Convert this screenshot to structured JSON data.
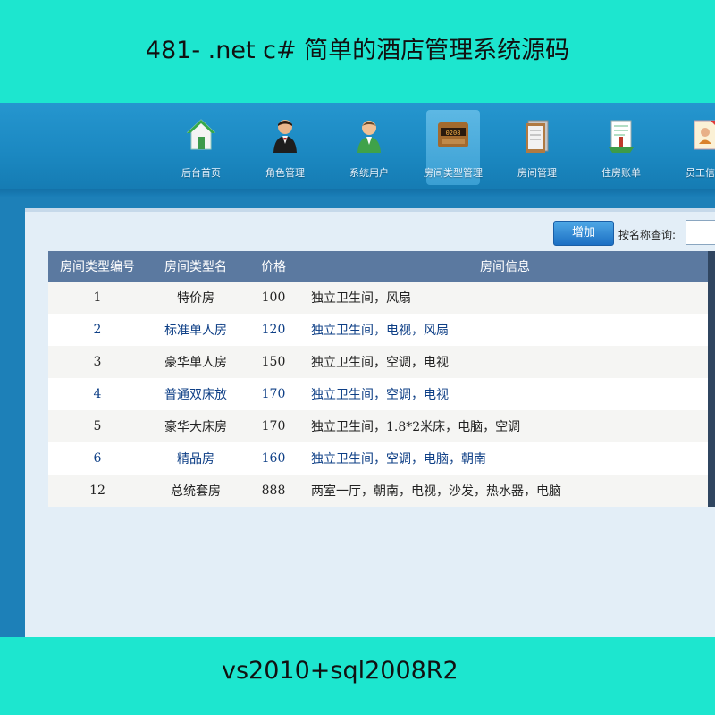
{
  "banner": {
    "title": "481- .net c# 简单的酒店管理系统源码",
    "footer": "vs2010+sql2008R2"
  },
  "nav": [
    {
      "label": "后台首页",
      "icon": "home-icon"
    },
    {
      "label": "角色管理",
      "icon": "waiter-icon"
    },
    {
      "label": "系统用户",
      "icon": "user-icon"
    },
    {
      "label": "房间类型管理",
      "icon": "room-type-icon",
      "active": true
    },
    {
      "label": "房间管理",
      "icon": "clipboard-icon"
    },
    {
      "label": "住房账单",
      "icon": "bill-icon"
    },
    {
      "label": "员工信息",
      "icon": "employee-icon"
    }
  ],
  "toolbar": {
    "add_label": "增加",
    "search_label": "按名称查询:",
    "search_value": ""
  },
  "table": {
    "headers": [
      "房间类型编号",
      "房间类型名",
      "价格",
      "房间信息"
    ],
    "rows": [
      {
        "id": "1",
        "name": "特价房",
        "price": "100",
        "info": "独立卫生间，风扇"
      },
      {
        "id": "2",
        "name": "标准单人房",
        "price": "120",
        "info": "独立卫生间，电视，风扇"
      },
      {
        "id": "3",
        "name": "豪华单人房",
        "price": "150",
        "info": "独立卫生间，空调，电视"
      },
      {
        "id": "4",
        "name": "普通双床放",
        "price": "170",
        "info": "独立卫生间，空调，电视"
      },
      {
        "id": "5",
        "name": "豪华大床房",
        "price": "170",
        "info": "独立卫生间，1.8*2米床，电脑，空调"
      },
      {
        "id": "6",
        "name": "精品房",
        "price": "160",
        "info": "独立卫生间，空调，电脑，朝南"
      },
      {
        "id": "12",
        "name": "总统套房",
        "price": "888",
        "info": "两室一厅，朝南，电视，沙发，热水器，电脑"
      }
    ]
  },
  "colors": {
    "banner": "#1de6cf",
    "header": "#1b88c1",
    "table_header": "#5b79a0",
    "link_row": "#0e3f86"
  }
}
